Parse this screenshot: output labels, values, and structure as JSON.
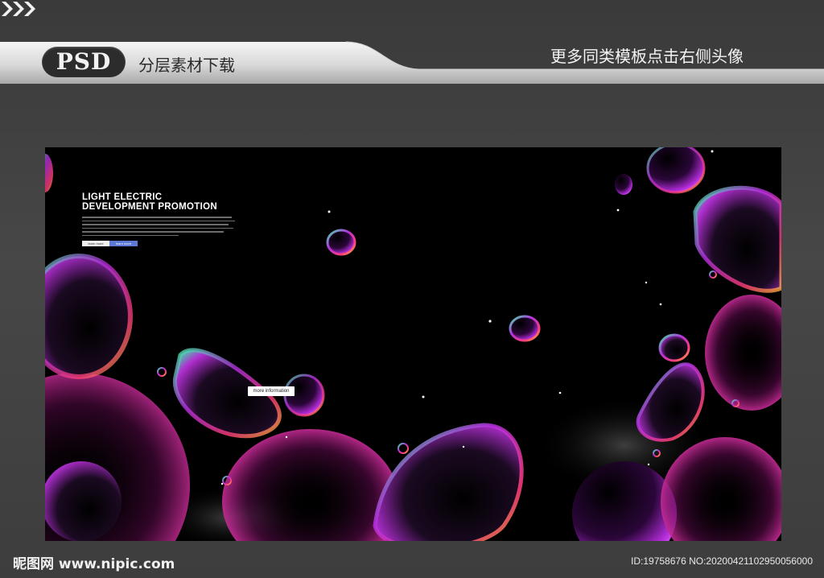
{
  "banner": {
    "badge": "PSD",
    "title": "分层素材下载",
    "promo": "更多同类模板点击右侧头像",
    "chevron_icon": "triple-chevron-right"
  },
  "poster": {
    "headline_line1": "LIGHT ELECTRIC",
    "headline_line2": "DEVELOPMENT PROMOTION",
    "button_left": "learn more",
    "button_right": "learn more",
    "more_button": "more information",
    "accent_color": "#5c79d6",
    "background_color": "#000000"
  },
  "footer": {
    "logo": "昵图网 www.nipic.com",
    "id_text": "ID:19758676 NO:20200421102950056000"
  }
}
